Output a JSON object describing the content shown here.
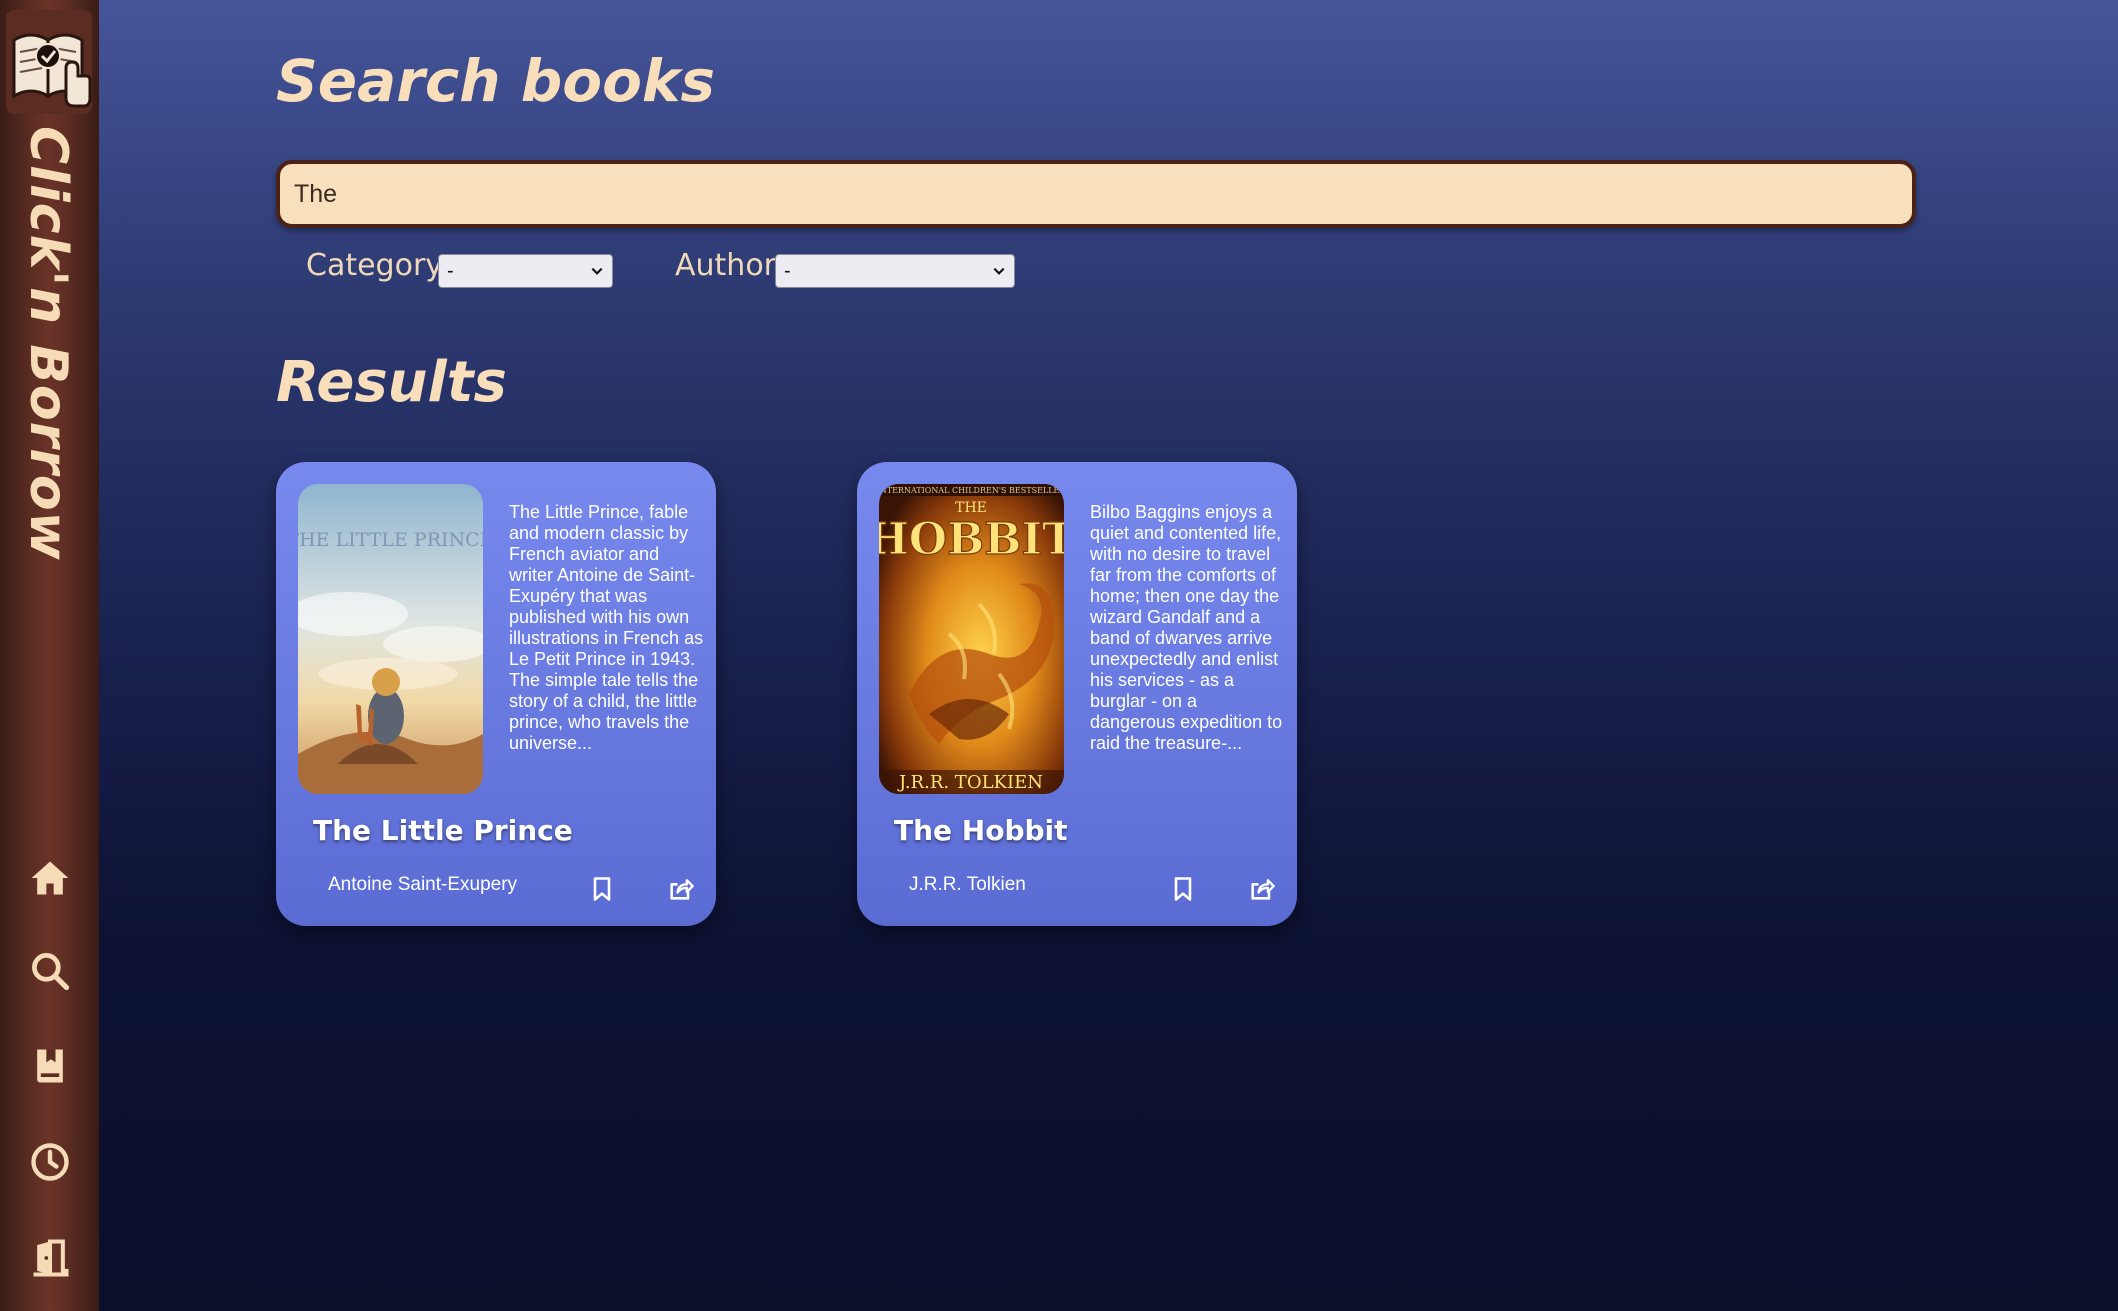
{
  "sidebar": {
    "brand": "Click'n Borrow",
    "nav": [
      {
        "name": "home-icon"
      },
      {
        "name": "search-icon"
      },
      {
        "name": "bookmark-book-icon"
      },
      {
        "name": "history-clock-icon"
      },
      {
        "name": "logout-door-icon"
      }
    ]
  },
  "search": {
    "heading": "Search books",
    "query": "The",
    "filters": {
      "category_label": "Category",
      "category_value": "-",
      "author_label": "Author",
      "author_value": "-"
    }
  },
  "results": {
    "heading": "Results",
    "books": [
      {
        "title": "The Little Prince",
        "author": "Antoine Saint-Exupery",
        "description": "The Little Prince, fable and modern classic by French aviator and writer Antoine de Saint-Exupéry that was published with his own illustrations in French as Le Petit Prince in 1943. The simple tale tells the story of a child, the little prince, who travels the universe...",
        "cover_text": "THE LITTLE PRINCE"
      },
      {
        "title": "The Hobbit",
        "author": "J.R.R. Tolkien",
        "description": "Bilbo Baggins enjoys a quiet and contented life, with no desire to travel far from the comforts of home; then one day the wizard Gandalf and a band of dwarves arrive unexpectedly and enlist his services - as a burglar - on a dangerous expedition to raid the treasure-...",
        "cover_top": "INTERNATIONAL CHILDREN'S BESTSELLER",
        "cover_the": "THE",
        "cover_title": "HOBBIT",
        "cover_author": "J.R.R. TOLKIEN"
      }
    ]
  },
  "colors": {
    "accent": "#f8deba",
    "sidebar": "#6b3328",
    "card": "#6f80e6"
  }
}
